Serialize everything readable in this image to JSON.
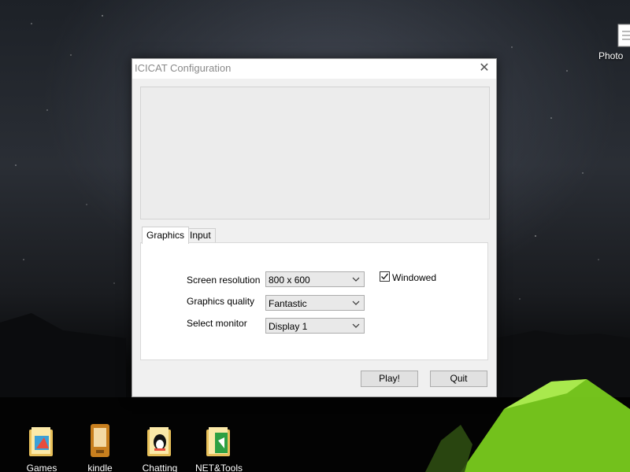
{
  "window": {
    "title": "ICICAT Configuration",
    "close_glyph": "✕"
  },
  "tabs": [
    {
      "label": "Graphics",
      "selected": true
    },
    {
      "label": "Input",
      "selected": false
    }
  ],
  "graphics": {
    "screen_resolution": {
      "label": "Screen resolution",
      "value": "800 x 600"
    },
    "graphics_quality": {
      "label": "Graphics quality",
      "value": "Fantastic"
    },
    "select_monitor": {
      "label": "Select monitor",
      "value": "Display 1"
    },
    "windowed": {
      "label": "Windowed",
      "checked": true
    }
  },
  "buttons": {
    "play": "Play!",
    "quit": "Quit"
  },
  "desktop": {
    "icons": [
      {
        "label": "Games",
        "icon": "folder-games-icon"
      },
      {
        "label": "kindle",
        "icon": "kindle-icon"
      },
      {
        "label": "Chatting",
        "icon": "folder-chat-icon"
      },
      {
        "label": "NET&Tools",
        "icon": "folder-tools-icon"
      },
      {
        "label": "Photo",
        "icon": "photo-file-icon"
      }
    ]
  },
  "colors": {
    "tent_glow": "#8fe32a",
    "dialog_bg": "#f0f0f0"
  }
}
